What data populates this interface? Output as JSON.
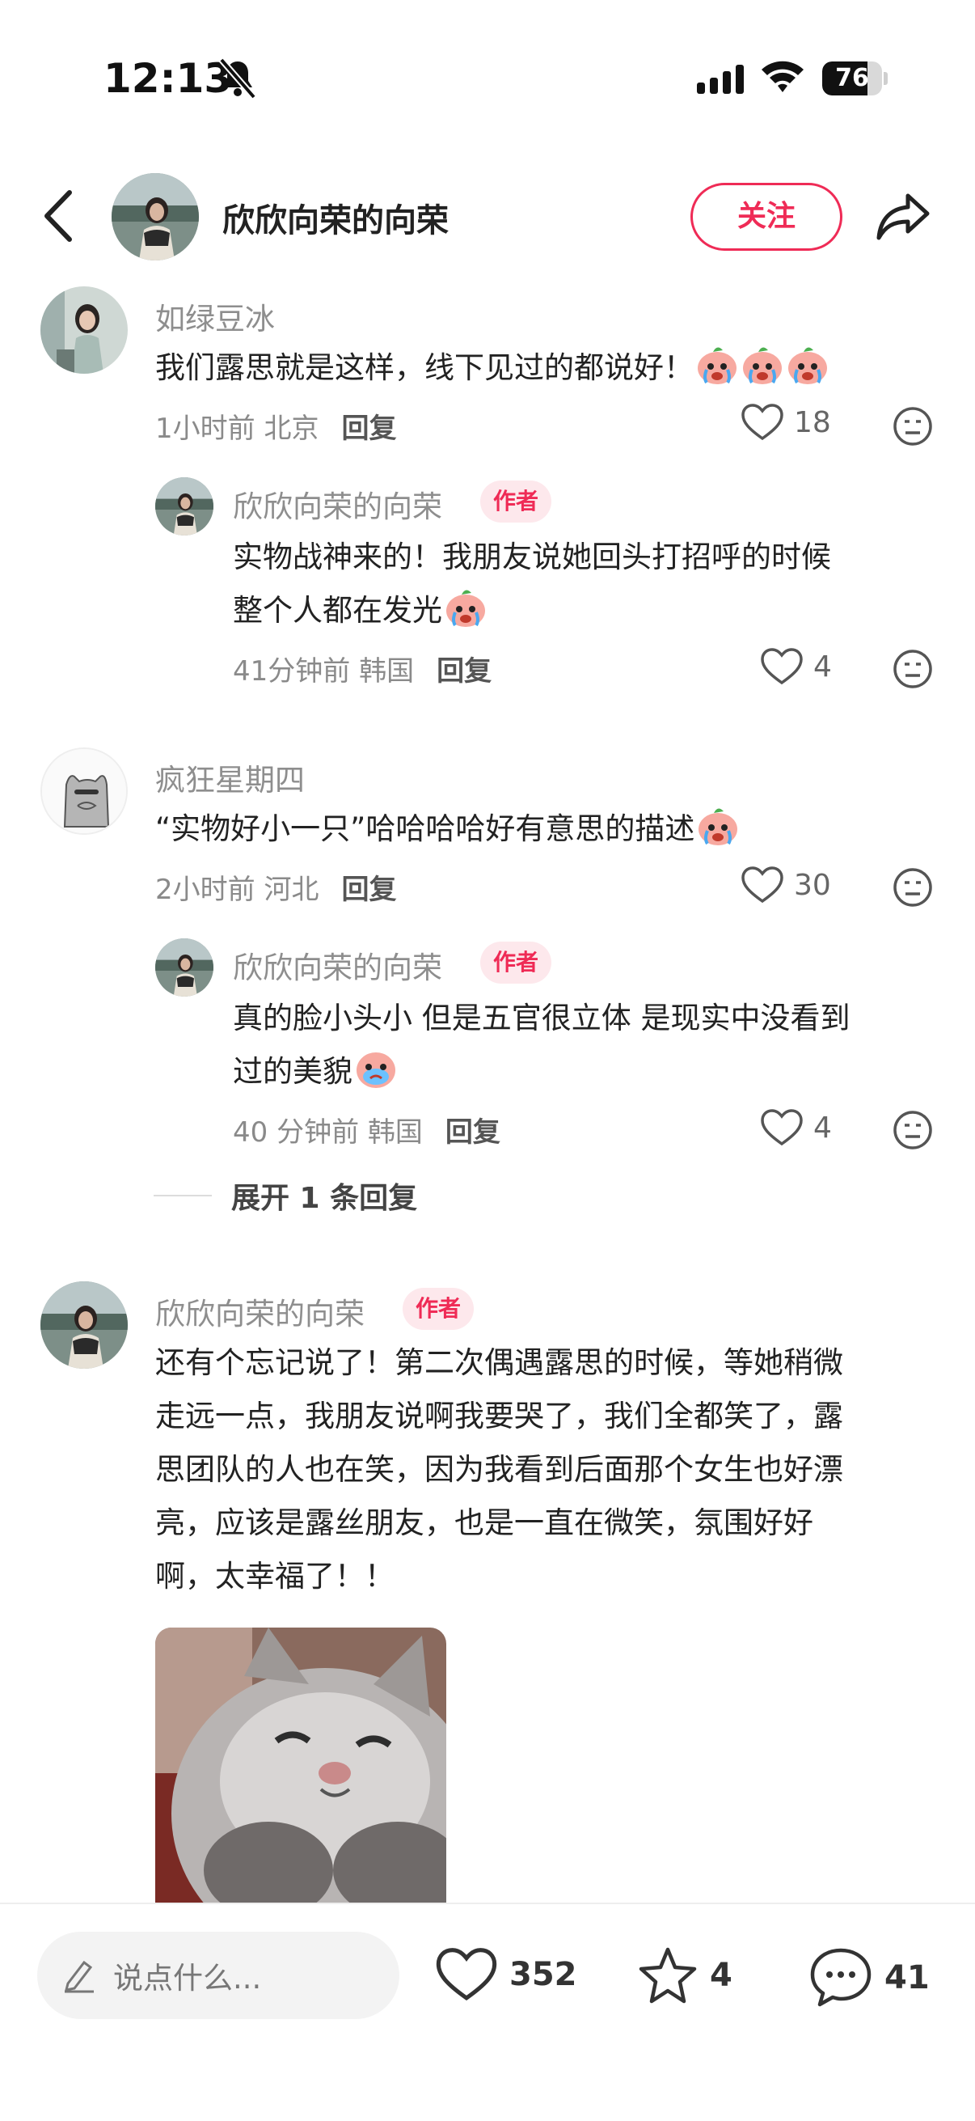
{
  "status": {
    "time": "12:13",
    "battery": "76",
    "battery_level": 0.76
  },
  "header": {
    "title": "欣欣向荣的向荣",
    "follow_label": "关注"
  },
  "comments": [
    {
      "user": "如绿豆冰",
      "text": "我们露思就是这样，线下见过的都说好！",
      "time": "1小时前",
      "location": "北京",
      "reply_label": "回复",
      "likes": "18",
      "replies": [
        {
          "user": "欣欣向荣的向荣",
          "tag": "作者",
          "text_line1": "实物战神来的！我朋友说她回头打招呼的时候",
          "text_line2": "整个人都在发光",
          "time": "41分钟前",
          "location": "韩国",
          "reply_label": "回复",
          "likes": "4"
        }
      ]
    },
    {
      "user": "疯狂星期四",
      "text": "“实物好小一只”哈哈哈哈好有意思的描述",
      "time": "2小时前",
      "location": "河北",
      "reply_label": "回复",
      "likes": "30",
      "replies": [
        {
          "user": "欣欣向荣的向荣",
          "tag": "作者",
          "text_line1": "真的脸小头小 但是五官很立体 是现实中没看到",
          "text_line2": "过的美貌",
          "time": "40 分钟前",
          "location": "韩国",
          "reply_label": "回复",
          "likes": "4"
        }
      ],
      "expand_label": "展开 1 条回复"
    },
    {
      "user": "欣欣向荣的向荣",
      "tag": "作者",
      "lines": [
        "还有个忘记说了！第二次偶遇露思的时候，等她稍微",
        "走远一点，我朋友说啊我要哭了，我们全都笑了，露",
        "思团队的人也在笑，因为我看到后面那个女生也好漂",
        "亮，应该是露丝朋友，也是一直在微笑，氛围好好",
        "啊，太幸福了！！"
      ]
    }
  ],
  "bottom": {
    "input_placeholder": "说点什么...",
    "likes": "352",
    "favorites": "4",
    "comments": "41"
  },
  "colors": {
    "accent": "#ef2b56",
    "tag_bg": "#fde8ec"
  }
}
